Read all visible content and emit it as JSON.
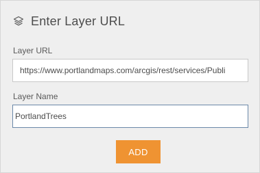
{
  "panel": {
    "title": "Enter Layer URL",
    "title_icon": "layers-icon"
  },
  "form": {
    "url_label": "Layer URL",
    "url_value": "https://www.portlandmaps.com/arcgis/rest/services/Publi",
    "name_label": "Layer Name",
    "name_value": "PortlandTrees",
    "add_label": "ADD"
  },
  "colors": {
    "panel_bg": "#efefef",
    "accent": "#ef9332",
    "focus_border": "#6a87a8"
  }
}
